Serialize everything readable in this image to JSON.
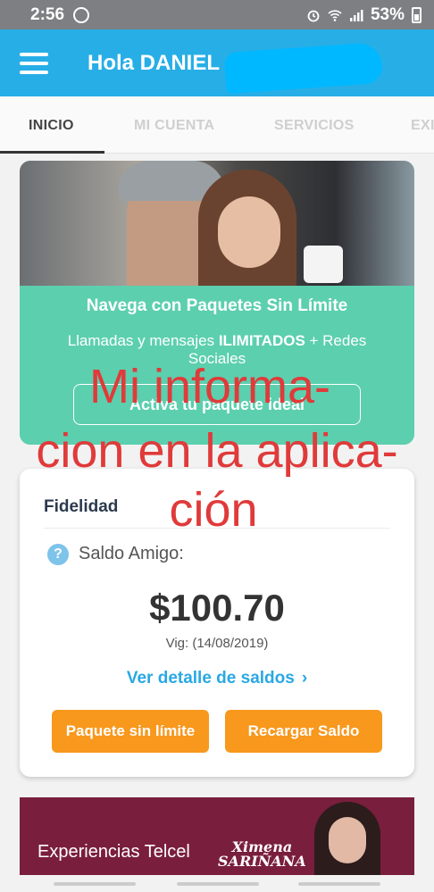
{
  "status_bar": {
    "time": "2:56",
    "battery": "53%"
  },
  "header": {
    "greeting": "Hola DANIEL"
  },
  "tabs": [
    {
      "label": "INICIO"
    },
    {
      "label": "MI CUENTA"
    },
    {
      "label": "SERVICIOS"
    },
    {
      "label": "EXI"
    }
  ],
  "promo": {
    "title": "Navega con Paquetes Sin Límite",
    "subtitle_pre": "Llamadas y mensajes ",
    "subtitle_bold": "ILIMITADOS",
    "subtitle_post": " + Redes Sociales",
    "button": "Activa tu paquete ideal"
  },
  "fidelidad": {
    "title": "Fidelidad",
    "help_symbol": "?",
    "saldo_label": "Saldo Amigo:",
    "amount": "$100.70",
    "vig": "Vig: (14/08/2019)",
    "detail_link": "Ver detalle de saldos",
    "detail_chevron": "›",
    "btn_paquete": "Paquete sin límite",
    "btn_recargar": "Recargar Saldo"
  },
  "overlay": {
    "line1": "Mi informa-",
    "line2": "cion en la aplica-",
    "line3": "ción"
  },
  "banner": {
    "text": "Experiencias Telcel",
    "brand_line1": "Ximena",
    "brand_line2": "SARIÑANA"
  },
  "colors": {
    "app_bar": "#28aee6",
    "accent_orange": "#f8981d",
    "promo_green": "#5ccfae",
    "link_blue": "#2aa8e3",
    "overlay_red": "#e03a3a"
  }
}
